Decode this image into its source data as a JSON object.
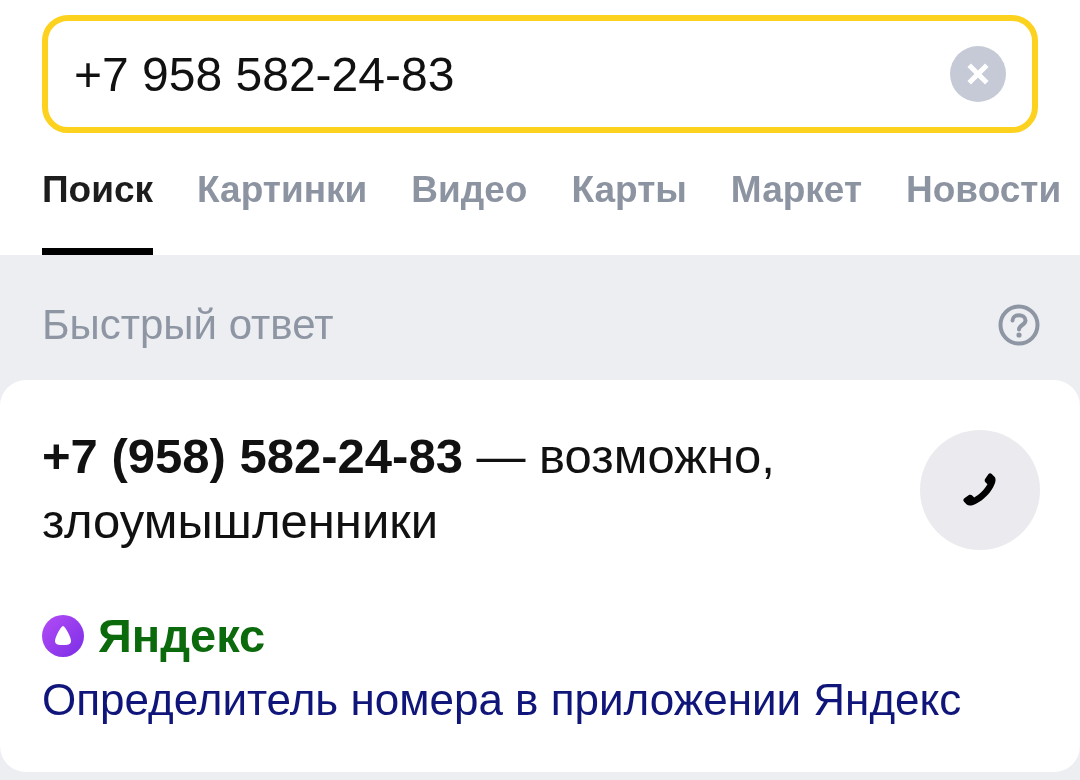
{
  "search": {
    "value": "+7 958 582-24-83"
  },
  "tabs": [
    {
      "label": "Поиск",
      "selected": true
    },
    {
      "label": "Картинки",
      "selected": false
    },
    {
      "label": "Видео",
      "selected": false
    },
    {
      "label": "Карты",
      "selected": false
    },
    {
      "label": "Маркет",
      "selected": false
    },
    {
      "label": "Новости",
      "selected": false
    }
  ],
  "quick_answer": {
    "heading": "Быстрый ответ"
  },
  "answer_card": {
    "text": "**+7 (958) 582-24-83** — возможно, злоумышленники",
    "source": "Яндекс",
    "link": "Определитель номера в приложении Яндекс"
  }
}
